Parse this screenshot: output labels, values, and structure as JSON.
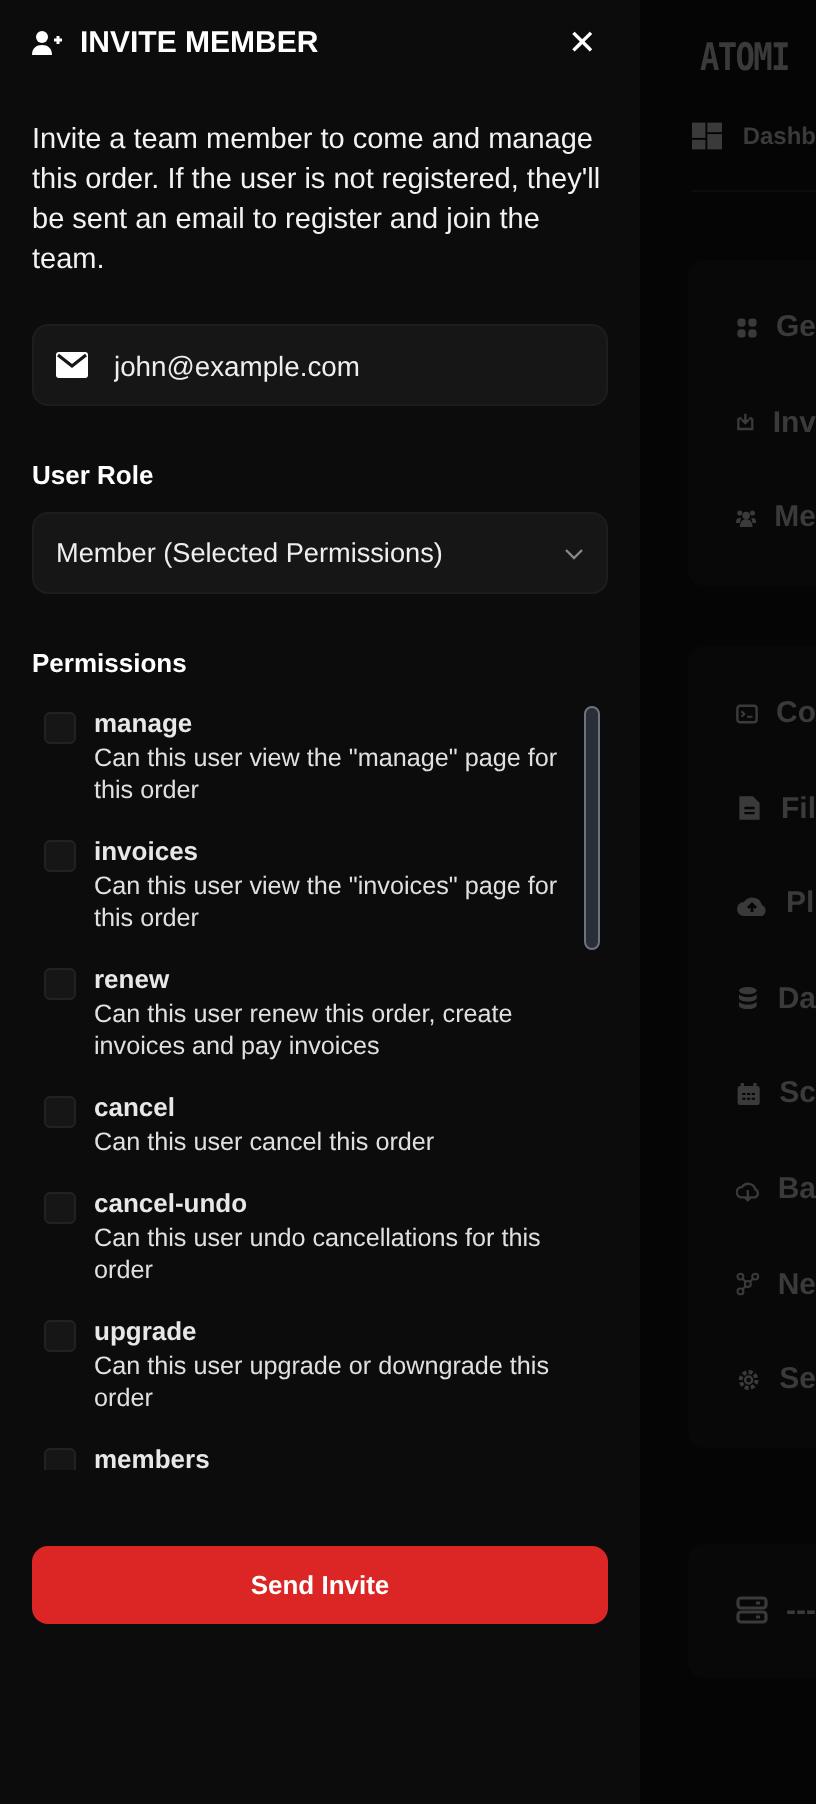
{
  "invite_panel": {
    "title": "INVITE MEMBER",
    "close": "✕",
    "description": "Invite a team member to come and manage this order. If the user is not registered, they'll be sent an email to register and join the team.",
    "email": {
      "value": "john@example.com"
    },
    "role": {
      "label": "User Role",
      "value": "Member (Selected Permissions)"
    },
    "permissions": {
      "label": "Permissions",
      "items": [
        {
          "name": "manage",
          "description": "Can this user view the \"manage\" page for this order",
          "checked": false
        },
        {
          "name": "invoices",
          "description": "Can this user view the \"invoices\" page for this order",
          "checked": false
        },
        {
          "name": "renew",
          "description": "Can this user renew this order, create invoices and pay invoices",
          "checked": false
        },
        {
          "name": "cancel",
          "description": "Can this user cancel this order",
          "checked": false
        },
        {
          "name": "cancel-undo",
          "description": "Can this user undo cancellations for this order",
          "checked": false
        },
        {
          "name": "upgrade",
          "description": "Can this user upgrade or downgrade this order",
          "checked": false
        },
        {
          "name": "members",
          "checked": false
        }
      ]
    },
    "submit": "Send Invite"
  },
  "background": {
    "logo": "ATOMI",
    "top_link": "Dashb",
    "nav_groups": [
      {
        "items": [
          "Ge",
          "Inv",
          "Me"
        ]
      },
      {
        "items": [
          "Co",
          "Fil",
          "Pl",
          "Da",
          "Sc",
          "Ba",
          "Ne",
          "Se"
        ]
      },
      {
        "items": [
          "---"
        ]
      }
    ]
  }
}
